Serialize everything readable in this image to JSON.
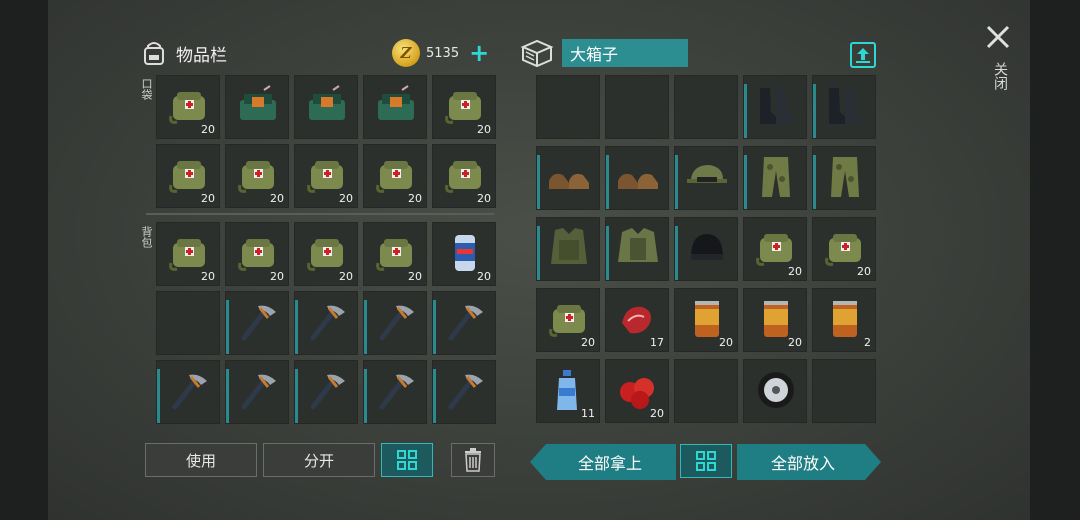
{
  "inventory": {
    "title": "物品栏",
    "coins": "5135",
    "pocket_label": "口袋",
    "backpack_label": "背包",
    "pocket_slots": [
      {
        "item": "medkit-bag",
        "count": "20"
      },
      {
        "item": "dynamite-pack",
        "count": ""
      },
      {
        "item": "dynamite-pack",
        "count": ""
      },
      {
        "item": "dynamite-pack",
        "count": ""
      },
      {
        "item": "medkit-bag",
        "count": "20"
      },
      {
        "item": "medkit-bag",
        "count": "20"
      },
      {
        "item": "medkit-bag",
        "count": "20"
      },
      {
        "item": "medkit-bag",
        "count": "20"
      },
      {
        "item": "medkit-bag",
        "count": "20"
      },
      {
        "item": "medkit-bag",
        "count": "20"
      }
    ],
    "backpack_slots": [
      {
        "item": "medkit-bag",
        "count": "20"
      },
      {
        "item": "medkit-bag",
        "count": "20"
      },
      {
        "item": "medkit-bag",
        "count": "20"
      },
      {
        "item": "medkit-bag",
        "count": "20"
      },
      {
        "item": "beer-can",
        "count": "20"
      },
      {
        "item": "",
        "count": ""
      },
      {
        "item": "pickaxe",
        "count": ""
      },
      {
        "item": "pickaxe",
        "count": ""
      },
      {
        "item": "pickaxe",
        "count": ""
      },
      {
        "item": "pickaxe",
        "count": ""
      },
      {
        "item": "pickaxe",
        "count": ""
      },
      {
        "item": "pickaxe",
        "count": ""
      },
      {
        "item": "pickaxe",
        "count": ""
      },
      {
        "item": "pickaxe",
        "count": ""
      },
      {
        "item": "pickaxe",
        "count": ""
      }
    ],
    "buttons": {
      "use": "使用",
      "split": "分开"
    }
  },
  "box": {
    "title": "大箱子",
    "slots": [
      {
        "item": "",
        "count": ""
      },
      {
        "item": "",
        "count": ""
      },
      {
        "item": "",
        "count": ""
      },
      {
        "item": "boots",
        "count": ""
      },
      {
        "item": "boots",
        "count": ""
      },
      {
        "item": "shoes",
        "count": ""
      },
      {
        "item": "shoes",
        "count": ""
      },
      {
        "item": "cap",
        "count": ""
      },
      {
        "item": "camo-pants",
        "count": ""
      },
      {
        "item": "camo-pants",
        "count": ""
      },
      {
        "item": "armor-vest",
        "count": ""
      },
      {
        "item": "armor-jacket",
        "count": ""
      },
      {
        "item": "beanie",
        "count": ""
      },
      {
        "item": "medkit-bag",
        "count": "20"
      },
      {
        "item": "medkit-bag",
        "count": "20"
      },
      {
        "item": "medkit-bag",
        "count": "20"
      },
      {
        "item": "raw-meat",
        "count": "17"
      },
      {
        "item": "food-can",
        "count": "20"
      },
      {
        "item": "food-can",
        "count": "20"
      },
      {
        "item": "food-can",
        "count": "2"
      },
      {
        "item": "water-bottle",
        "count": "11"
      },
      {
        "item": "tomatoes",
        "count": "20"
      },
      {
        "item": "",
        "count": ""
      },
      {
        "item": "wheel",
        "count": ""
      },
      {
        "item": "",
        "count": ""
      }
    ],
    "buttons": {
      "take_all": "全部拿上",
      "put_all": "全部放入"
    }
  },
  "close_label": "关闭",
  "colors": {
    "accent": "#2fd7d4",
    "slot_bg": "#2c302d",
    "teal_button": "#1f7e83"
  }
}
